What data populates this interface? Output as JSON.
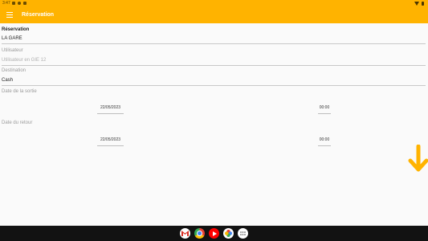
{
  "status_bar": {
    "time": "3:47"
  },
  "app_bar": {
    "title": "Réservation"
  },
  "form": {
    "section_title": "Réservation",
    "location_value": "LA GARE",
    "user_label": "Utilisateur",
    "user_value": "Utilisateur en GIE 12",
    "destination_label": "Destination",
    "destination_value": "Cash",
    "departure_label": "Date de la sortie",
    "departure_date": "22/05/2023",
    "departure_time": "00:00",
    "return_label": "Date du retour",
    "return_date": "22/05/2023",
    "return_time": "00:00"
  },
  "nav_apps": [
    "gmail-icon",
    "chrome-icon",
    "youtube-icon",
    "photos-icon",
    "app-drawer-icon"
  ],
  "colors": {
    "accent": "#ffb300",
    "fab_arrow": "#ffb300"
  }
}
